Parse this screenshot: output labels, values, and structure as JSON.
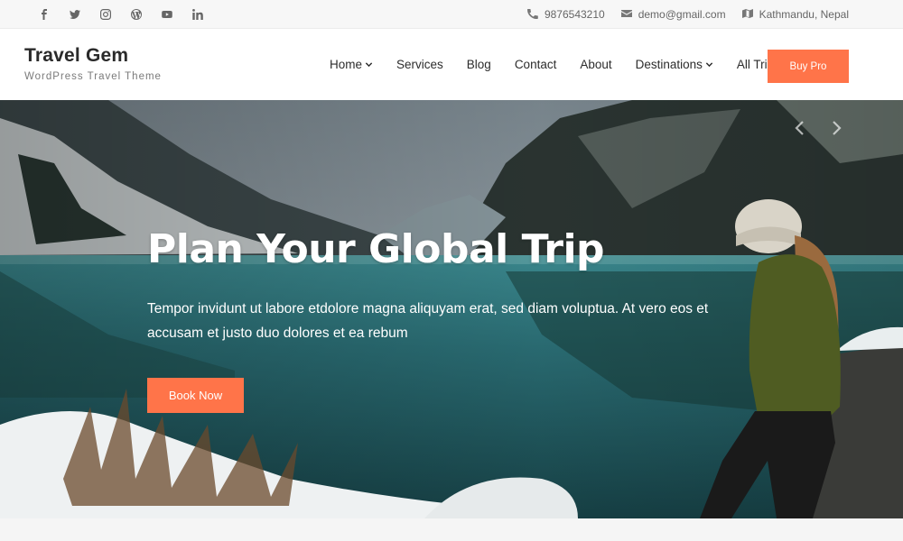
{
  "topbar": {
    "social": [
      {
        "name": "facebook-icon",
        "glyph": "f"
      },
      {
        "name": "twitter-icon",
        "glyph": "t"
      },
      {
        "name": "instagram-icon",
        "glyph": "i"
      },
      {
        "name": "wordpress-icon",
        "glyph": "w"
      },
      {
        "name": "youtube-icon",
        "glyph": "y"
      },
      {
        "name": "linkedin-icon",
        "glyph": "in"
      }
    ],
    "phone": "9876543210",
    "email": "demo@gmail.com",
    "location": "Kathmandu, Nepal"
  },
  "brand": {
    "title": "Travel Gem",
    "tagline": "WordPress Travel Theme"
  },
  "nav": {
    "items": [
      {
        "label": "Home",
        "dropdown": true
      },
      {
        "label": "Services",
        "dropdown": false
      },
      {
        "label": "Blog",
        "dropdown": false
      },
      {
        "label": "Contact",
        "dropdown": false
      },
      {
        "label": "About",
        "dropdown": false
      },
      {
        "label": "Destinations",
        "dropdown": true
      },
      {
        "label": "All Trips",
        "dropdown": false
      }
    ],
    "buy_label": "Buy Pro"
  },
  "hero": {
    "title": "Plan Your Global Trip",
    "text": "Tempor invidunt ut labore etdolore magna aliquyam erat, sed diam voluptua. At vero eos et accusam et justo duo dolores et ea rebum",
    "button_label": "Book Now"
  },
  "colors": {
    "accent": "#ff7449",
    "lake": "#2f7d84",
    "text_dark": "#2c2c2c"
  }
}
